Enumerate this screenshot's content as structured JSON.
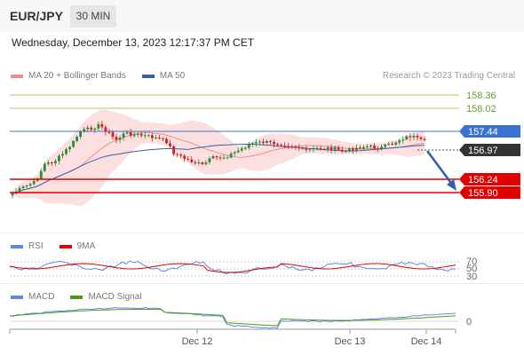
{
  "header": {
    "pair": "EUR/JPY",
    "timeframe": "30 MIN",
    "datetime": "Wednesday, December 13, 2023 12:17:37 PM CET"
  },
  "main_legend": {
    "items": [
      {
        "label": "MA 20 + Bollinger Bands",
        "color": "#f28a8a"
      },
      {
        "label": "MA 50",
        "color": "#3560a8"
      }
    ],
    "credit": "Research © 2023 Trading Central"
  },
  "price_levels": [
    {
      "value": "158.36",
      "type": "resistance-green",
      "color": "#8fc14a"
    },
    {
      "value": "158.02",
      "type": "resistance-green",
      "color": "#8fc14a"
    },
    {
      "value": "157.44",
      "type": "pivot",
      "color": "#3b73d4"
    },
    {
      "value": "156.97",
      "type": "current",
      "color": "#333333"
    },
    {
      "value": "156.24",
      "type": "support",
      "color": "#e00000"
    },
    {
      "value": "155.90",
      "type": "support",
      "color": "#e00000"
    }
  ],
  "rsi_panel": {
    "legend": [
      {
        "label": "RSI",
        "color": "#5b8be0"
      },
      {
        "label": "9MA",
        "color": "#e00000"
      }
    ],
    "levels": [
      "70",
      "50",
      "30"
    ]
  },
  "macd_panel": {
    "legend": [
      {
        "label": "MACD",
        "color": "#5b8be0"
      },
      {
        "label": "MACD Signal",
        "color": "#4a9a1a"
      }
    ],
    "zero_label": "0"
  },
  "x_axis": {
    "labels": [
      "Dec 12",
      "Dec 13",
      "Dec 14"
    ]
  },
  "colors": {
    "candle_up": "#2a8a3a",
    "candle_down": "#d22020",
    "bollinger_fill": "#fbd3d3",
    "ma20": "#f28a8a",
    "ma50": "#3560a8",
    "forecast_arrow": "#2f5fa8"
  }
}
